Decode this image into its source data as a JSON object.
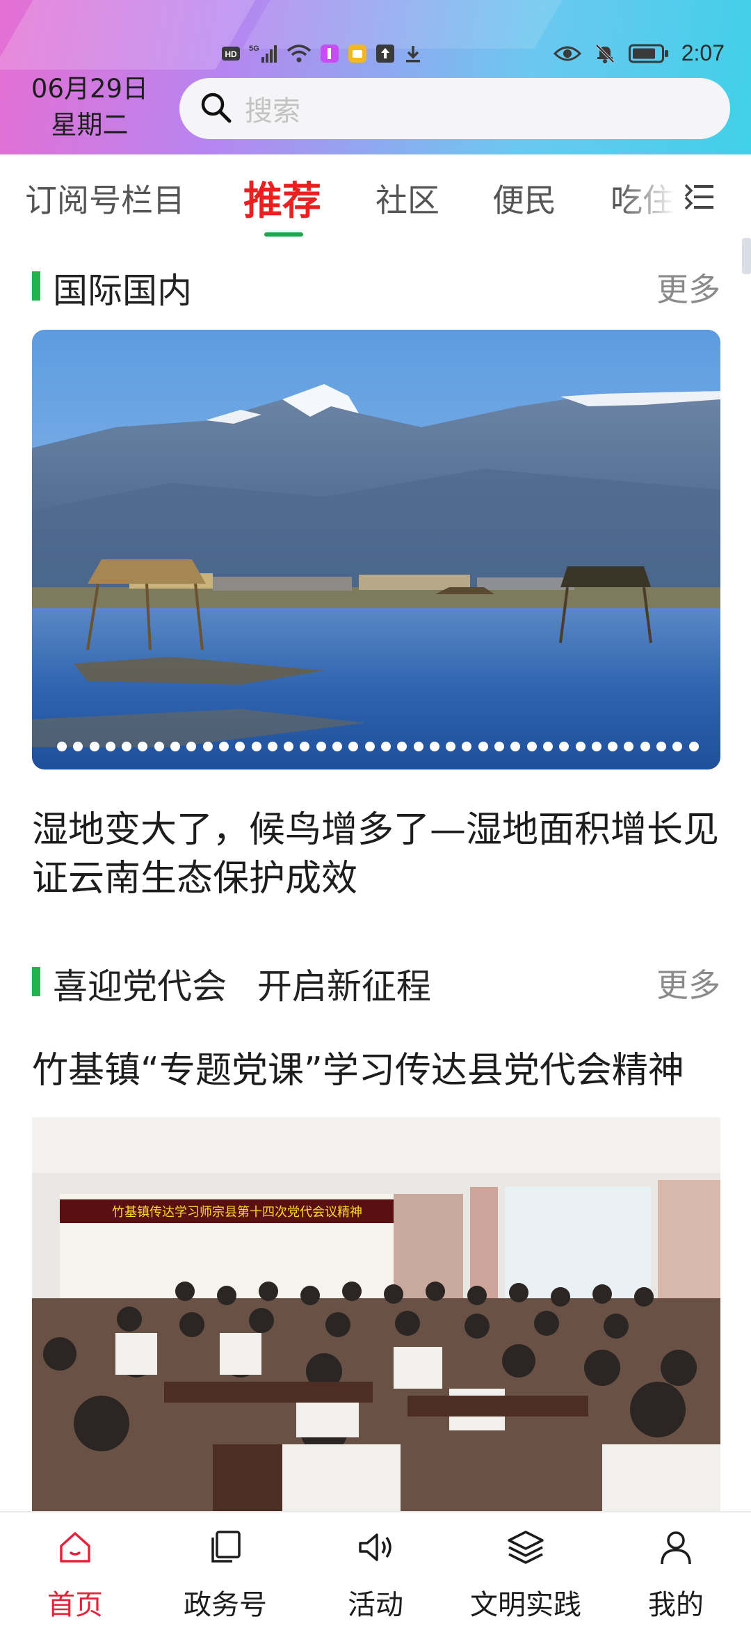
{
  "status_bar": {
    "left_icons": [
      "hd-icon",
      "5g-signal-icon",
      "wifi-icon",
      "app-notification-icon",
      "app-notification-icon",
      "upload-icon",
      "download-icon"
    ],
    "right_icons": [
      "eye-icon",
      "bell-muted-icon",
      "battery-icon"
    ],
    "time": "2:07"
  },
  "header": {
    "date": "06月29日",
    "weekday": "星期二",
    "search_placeholder": "搜索"
  },
  "tabs": {
    "items": [
      "订阅号栏目",
      "推荐",
      "社区",
      "便民",
      "吃住"
    ],
    "active": "推荐"
  },
  "section1": {
    "title": "国际国内",
    "more": "更多",
    "headline": "湿地变大了，候鸟增多了—湿地面积增长见证云南生态保护成效",
    "carousel_dot_count": 40
  },
  "section2": {
    "title": "喜迎党代会 开启新征程",
    "more": "更多",
    "headline": "竹基镇“专题党课”学习传达县党代会精神",
    "banner_text": "竹基镇传达学习师宗县第十四次党代会议精神"
  },
  "bottom_nav": {
    "items": [
      {
        "label": "首页",
        "icon": "home-icon"
      },
      {
        "label": "政务号",
        "icon": "pages-icon"
      },
      {
        "label": "活动",
        "icon": "speaker-icon"
      },
      {
        "label": "文明实践",
        "icon": "layers-icon"
      },
      {
        "label": "我的",
        "icon": "user-icon"
      }
    ],
    "active": "首页"
  },
  "colors": {
    "accent_red": "#ea1f1f",
    "section_bar_green": "#22b14c",
    "nav_active": "#e8203a"
  }
}
